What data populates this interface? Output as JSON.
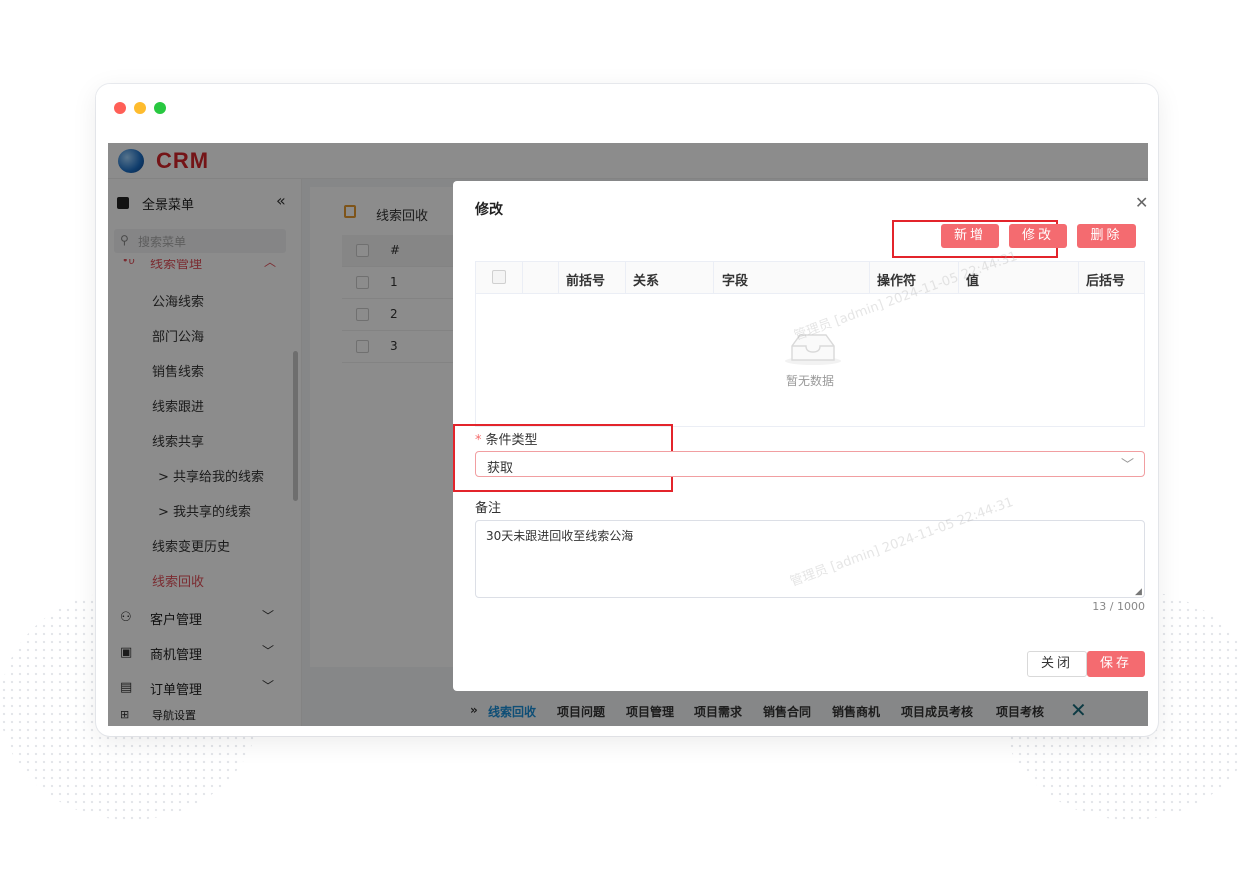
{
  "app": {
    "logo_text": "CRM"
  },
  "sidebar": {
    "header_label": "全景菜单",
    "collapse_glyph": "«",
    "search_placeholder": "搜索菜单",
    "group_top_label": "线索管理",
    "items": [
      {
        "label": "公海线索",
        "active": false
      },
      {
        "label": "部门公海",
        "active": false
      },
      {
        "label": "销售线索",
        "active": false
      },
      {
        "label": "线索跟进",
        "active": false
      },
      {
        "label": "线索共享",
        "active": false
      },
      {
        "label": "> 共享给我的线索",
        "active": false
      },
      {
        "label": "> 我共享的线索",
        "active": false
      },
      {
        "label": "线索变更历史",
        "active": false
      },
      {
        "label": "线索回收",
        "active": true
      }
    ],
    "sections": [
      {
        "label": "客户管理",
        "icon": "customer-icon"
      },
      {
        "label": "商机管理",
        "icon": "briefcase-icon"
      },
      {
        "label": "订单管理",
        "icon": "order-icon"
      },
      {
        "label": "导航设置",
        "icon": "nav-grid-icon"
      }
    ]
  },
  "main": {
    "breadcrumb": "线索回收",
    "table": {
      "header_num": "#",
      "rows": [
        "1",
        "2",
        "3"
      ]
    }
  },
  "tabs": {
    "chevron": "»",
    "items": [
      {
        "label": "线索回收",
        "active": true
      },
      {
        "label": "项目问题",
        "active": false
      },
      {
        "label": "项目管理",
        "active": false
      },
      {
        "label": "项目需求",
        "active": false
      },
      {
        "label": "销售合同",
        "active": false
      },
      {
        "label": "销售商机",
        "active": false
      },
      {
        "label": "项目成员考核",
        "active": false
      },
      {
        "label": "项目考核",
        "active": false
      }
    ]
  },
  "dialog": {
    "title": "修改",
    "toolbar": {
      "add": "新增",
      "edit": "修改",
      "delete": "删除"
    },
    "grid": {
      "columns": [
        "前括号",
        "关系",
        "字段",
        "操作符",
        "值",
        "后括号"
      ],
      "empty_text": "暂无数据"
    },
    "condition_type": {
      "label": "条件类型",
      "required_mark": "*",
      "value": "获取"
    },
    "remark": {
      "label": "备注",
      "value": "30天未跟进回收至线索公海",
      "counter": "13 / 1000"
    },
    "buttons": {
      "close": "关闭",
      "save": "保存"
    }
  },
  "watermark": "管理员 [admin] 2024-11-05 22:44:31",
  "colors": {
    "accent_red": "#f46b70",
    "highlight_red": "#e3242b",
    "brand_red": "#d4262b",
    "active_tab": "#1a8fd8"
  }
}
